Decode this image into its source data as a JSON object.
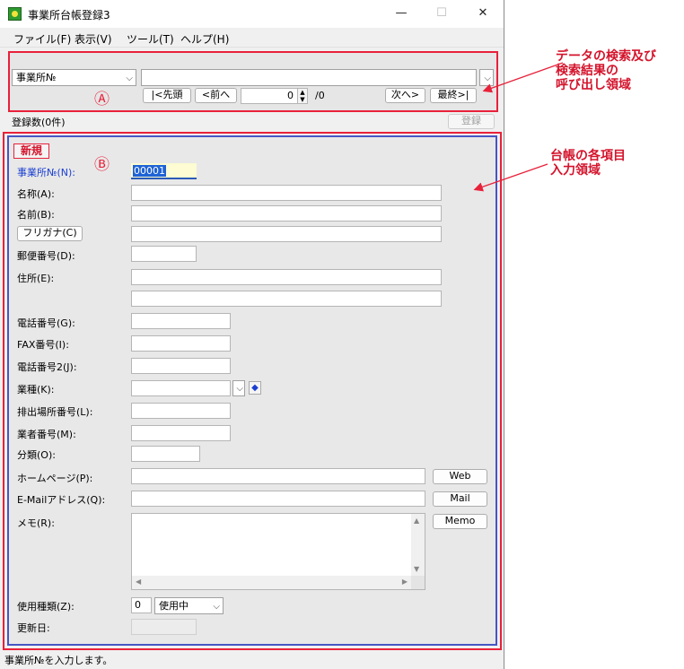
{
  "window": {
    "title": "事業所台帳登録3",
    "minimize": "—",
    "maximize": "☐",
    "close": "✕"
  },
  "menu": [
    "ファイル(F)",
    "表示(V)",
    "ツール(T)",
    "ヘルプ(H)"
  ],
  "nav": {
    "search_field": "事業所№",
    "search_value": "",
    "first": "|<先頭",
    "prev": "<前へ",
    "position": "0",
    "total": "/0",
    "next": "次へ>",
    "last": "最終>|",
    "marker": "Ⓐ"
  },
  "register_count": "登録数(0件)",
  "register_button": "登録",
  "form": {
    "mode": "新規",
    "marker": "Ⓑ",
    "labels": {
      "office_no": "事業所№(N):",
      "name": "名称(A):",
      "person": "名前(B):",
      "furigana_btn": "フリガナ(C)",
      "postal": "郵便番号(D):",
      "address": "住所(E):",
      "phone": "電話番号(G):",
      "fax": "FAX番号(I):",
      "phone2": "電話番号2(J):",
      "industry": "業種(K):",
      "discharge_no": "排出場所番号(L):",
      "vendor_no": "業者番号(M):",
      "category": "分類(O):",
      "homepage": "ホームページ(P):",
      "email": "E-Mailアドレス(Q):",
      "memo": "メモ(R):",
      "usage_type": "使用種類(Z):",
      "updated": "更新日:"
    },
    "values": {
      "office_no": "00001",
      "usage_code": "0",
      "usage_status": "使用中"
    },
    "buttons": {
      "web": "Web",
      "mail": "Mail",
      "memo": "Memo"
    }
  },
  "status_text": "事業所№を入力します。",
  "annotations": {
    "a_lines": [
      "データの検索及び",
      "検索結果の",
      "呼び出し領域"
    ],
    "b_lines": [
      "台帳の各項目",
      "入力領域"
    ]
  },
  "colors": {
    "annotation_red": "#e8213a",
    "form_border_blue": "#4655c4",
    "office_no_label": "#1a3fd0"
  }
}
